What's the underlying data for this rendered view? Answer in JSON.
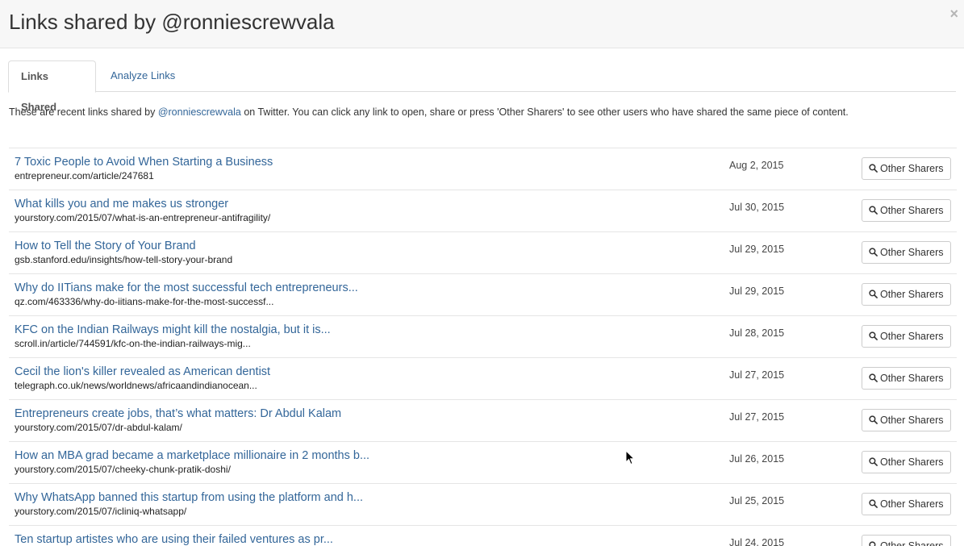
{
  "header": {
    "title": "Links shared by @ronniescrewvala",
    "close_symbol": "×"
  },
  "tabs": [
    {
      "label": "Links Shared",
      "active": true
    },
    {
      "label": "Analyze Links",
      "active": false
    }
  ],
  "intro": {
    "before": "These are recent links shared by ",
    "handle": "@ronniescrewvala",
    "after": " on Twitter. You can click any link to open, share or press 'Other Sharers' to see other users who have shared the same piece of content."
  },
  "button_label": "Other Sharers",
  "colors": {
    "link": "#336699",
    "header_bg": "#f7f7f7",
    "border": "#e5e5e5"
  },
  "links": [
    {
      "title": "7 Toxic People to Avoid When Starting a Business",
      "url": "entrepreneur.com/article/247681",
      "date": "Aug 2, 2015"
    },
    {
      "title": "What kills you and me makes us stronger",
      "url": "yourstory.com/2015/07/what-is-an-entrepreneur-antifragility/",
      "date": "Jul 30, 2015"
    },
    {
      "title": "How to Tell the Story of Your Brand",
      "url": "gsb.stanford.edu/insights/how-tell-story-your-brand",
      "date": "Jul 29, 2015"
    },
    {
      "title": "Why do IITians make for the most successful tech entrepreneurs...",
      "url": "qz.com/463336/why-do-iitians-make-for-the-most-successf...",
      "date": "Jul 29, 2015"
    },
    {
      "title": "KFC on the Indian Railways might kill the nostalgia, but it is...",
      "url": "scroll.in/article/744591/kfc-on-the-indian-railways-mig...",
      "date": "Jul 28, 2015"
    },
    {
      "title": "Cecil the lion's killer revealed as American dentist",
      "url": "telegraph.co.uk/news/worldnews/africaandindianocean...",
      "date": "Jul 27, 2015"
    },
    {
      "title": "Entrepreneurs create jobs, that’s what matters: Dr Abdul Kalam",
      "url": "yourstory.com/2015/07/dr-abdul-kalam/",
      "date": "Jul 27, 2015"
    },
    {
      "title": "How an MBA grad became a marketplace millionaire in 2 months b...",
      "url": "yourstory.com/2015/07/cheeky-chunk-pratik-doshi/",
      "date": "Jul 26, 2015"
    },
    {
      "title": "Why WhatsApp banned this startup from using the platform and h...",
      "url": "yourstory.com/2015/07/icliniq-whatsapp/",
      "date": "Jul 25, 2015"
    },
    {
      "title": "Ten startup artistes who are using their failed ventures as pr...",
      "url": "",
      "date": "Jul 24, 2015"
    }
  ]
}
